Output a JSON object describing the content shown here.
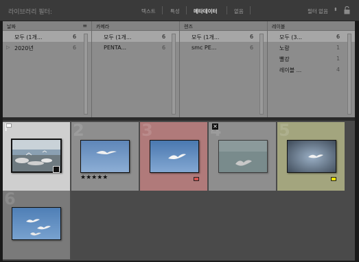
{
  "filter_bar": {
    "label": "라이브러리 필터:",
    "tabs": [
      {
        "label": "텍스트",
        "active": false
      },
      {
        "label": "특성",
        "active": false
      },
      {
        "label": "메타데이터",
        "active": true
      },
      {
        "label": "없음",
        "active": false
      }
    ],
    "preset": "필터 없음"
  },
  "metadata_columns": [
    {
      "header": "날짜",
      "rows": [
        {
          "label": "모두 (1개...",
          "count": "6",
          "selected": true,
          "expand": false
        },
        {
          "label": "2020년",
          "count": "6",
          "selected": false,
          "expand": true
        }
      ]
    },
    {
      "header": "카메라",
      "rows": [
        {
          "label": "모두 (1개...",
          "count": "6",
          "selected": true,
          "expand": false
        },
        {
          "label": "PENTA...",
          "count": "6",
          "selected": false,
          "expand": false
        }
      ]
    },
    {
      "header": "렌즈",
      "rows": [
        {
          "label": "모두 (1개...",
          "count": "6",
          "selected": true,
          "expand": false
        },
        {
          "label": "smc PE...",
          "count": "6",
          "selected": false,
          "expand": false
        }
      ]
    },
    {
      "header": "레이블",
      "rows": [
        {
          "label": "모두 (3...",
          "count": "6",
          "selected": true,
          "expand": false
        },
        {
          "label": "노랑",
          "count": "1",
          "selected": false,
          "expand": false
        },
        {
          "label": "빨강",
          "count": "1",
          "selected": false,
          "expand": false
        },
        {
          "label": "레이블 ...",
          "count": "4",
          "selected": false,
          "expand": false
        }
      ]
    }
  ],
  "photos": [
    {
      "index": "1",
      "label_color": "",
      "stars": "",
      "flag": "pick",
      "selected": true
    },
    {
      "index": "2",
      "label_color": "",
      "stars": "★★★★★",
      "flag": "",
      "selected": false
    },
    {
      "index": "3",
      "label_color": "#d9534f",
      "stars": "",
      "flag": "",
      "selected": false
    },
    {
      "index": "4",
      "label_color": "",
      "stars": "",
      "flag": "reject",
      "selected": false
    },
    {
      "index": "5",
      "label_color": "#f2e600",
      "stars": "",
      "flag": "",
      "selected": false
    },
    {
      "index": "6",
      "label_color": "",
      "stars": "",
      "flag": "",
      "selected": false
    }
  ],
  "colors": {
    "red_cell": "#b07a7a",
    "yellow_cell": "#a3a57e",
    "selected_cell": "#cfcfcf",
    "normal_cell": "#8e8e8e",
    "row_cell": "#7a7a7a"
  },
  "icons": {
    "lock": "lock-icon",
    "dropdown": "chevron-down-icon",
    "menu": "menu-icon"
  }
}
